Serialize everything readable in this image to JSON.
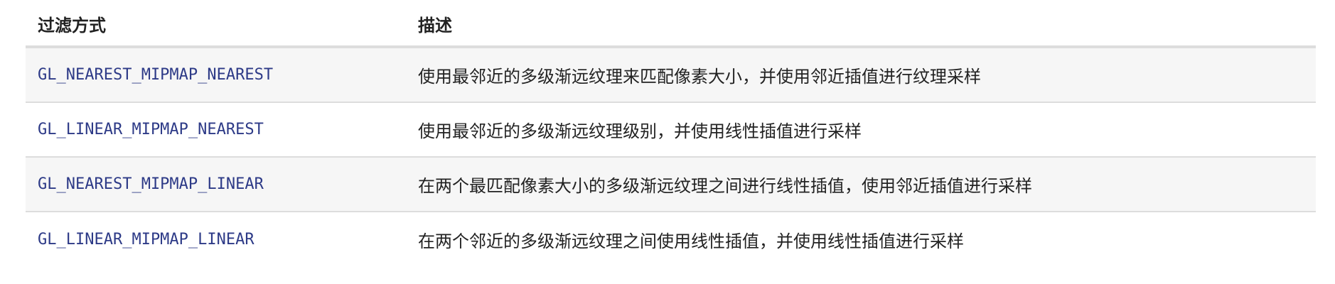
{
  "table": {
    "headers": {
      "mode": "过滤方式",
      "description": "描述"
    },
    "rows": [
      {
        "mode": "GL_NEAREST_MIPMAP_NEAREST",
        "description": "使用最邻近的多级渐远纹理来匹配像素大小，并使用邻近插值进行纹理采样"
      },
      {
        "mode": "GL_LINEAR_MIPMAP_NEAREST",
        "description": "使用最邻近的多级渐远纹理级别，并使用线性插值进行采样"
      },
      {
        "mode": "GL_NEAREST_MIPMAP_LINEAR",
        "description": "在两个最匹配像素大小的多级渐远纹理之间进行线性插值，使用邻近插值进行采样"
      },
      {
        "mode": "GL_LINEAR_MIPMAP_LINEAR",
        "description": "在两个邻近的多级渐远纹理之间使用线性插值，并使用线性插值进行采样"
      }
    ]
  },
  "colors": {
    "code_text": "#2d3a87",
    "body_text": "#222222",
    "row_shade": "#f6f6f6",
    "border": "#dddddd"
  }
}
